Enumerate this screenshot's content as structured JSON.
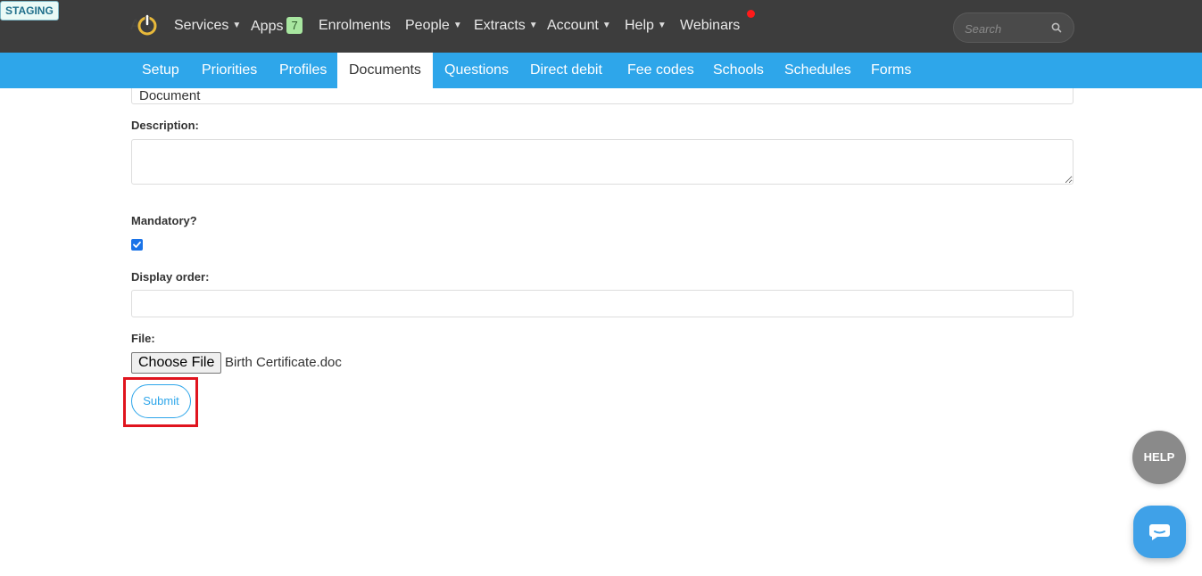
{
  "env_badge": "STAGING",
  "nav": {
    "items": [
      {
        "label": "Services",
        "caret": true
      },
      {
        "label": "Apps",
        "badge": "7"
      },
      {
        "label": "Enrolments"
      },
      {
        "label": "People",
        "caret": true
      },
      {
        "label": "Extracts",
        "caret": true
      },
      {
        "label": "Account",
        "caret": true
      },
      {
        "label": "Help",
        "caret": true
      },
      {
        "label": "Webinars"
      }
    ],
    "search_placeholder": "Search"
  },
  "subnav": {
    "tabs": [
      "Setup",
      "Priorities",
      "Profiles",
      "Documents",
      "Questions",
      "Direct debit",
      "Fee codes",
      "Schools",
      "Schedules",
      "Forms"
    ],
    "active": "Documents"
  },
  "form": {
    "label_value": "Document",
    "description_label": "Description:",
    "description_value": "",
    "mandatory_label": "Mandatory?",
    "mandatory_checked": true,
    "display_order_label": "Display order:",
    "display_order_value": "",
    "file_label": "File:",
    "file_button": "Choose File",
    "file_name": "Birth Certificate.doc",
    "submit_label": "Submit"
  },
  "widgets": {
    "help_label": "HELP"
  },
  "colors": {
    "topbar": "#3d3d3d",
    "subnav": "#2ea6ea",
    "highlight": "#e0141e"
  }
}
